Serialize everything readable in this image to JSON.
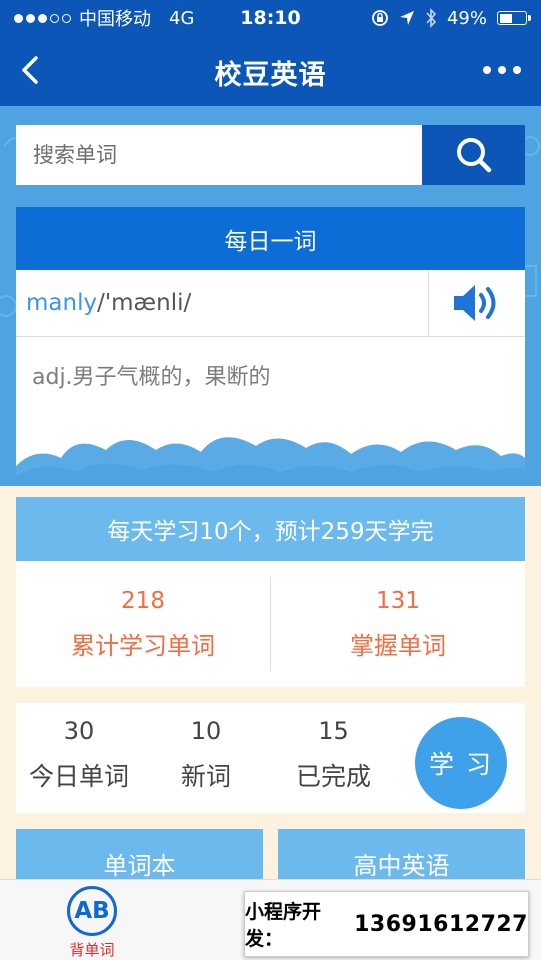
{
  "status_bar": {
    "carrier": "中国移动",
    "network": "4G",
    "time": "18:10",
    "battery": "49%",
    "battery_level": 0.49
  },
  "nav": {
    "title": "校豆英语",
    "back_icon": "chevron-left-icon",
    "more_icon": "more-dots-icon"
  },
  "search": {
    "placeholder": "搜索单词",
    "icon": "search-icon"
  },
  "daily_word": {
    "header": "每日一词",
    "word": "manly",
    "phonetic": "/'mænli/",
    "meaning": "adj.男子气概的，果断的",
    "speaker_icon": "speaker-icon"
  },
  "plan": {
    "header": "每天学习10个，预计259天学完",
    "stats": [
      {
        "value": "218",
        "label": "累计学习单词"
      },
      {
        "value": "131",
        "label": "掌握单词"
      }
    ]
  },
  "today": {
    "items": [
      {
        "value": "30",
        "label": "今日单词"
      },
      {
        "value": "10",
        "label": "新词"
      },
      {
        "value": "15",
        "label": "已完成"
      }
    ],
    "learn_button": "学习"
  },
  "categories": [
    "单词本",
    "高中英语"
  ],
  "tabbar": {
    "active_icon_text": "AB",
    "active_label": "背单词"
  },
  "banner": {
    "label": "小程序开发：",
    "phone": "13691612727"
  },
  "colors": {
    "primary": "#0c56b8",
    "light_blue": "#6cb9ed",
    "accent_orange": "#f06e42",
    "background": "#fdf1df"
  }
}
